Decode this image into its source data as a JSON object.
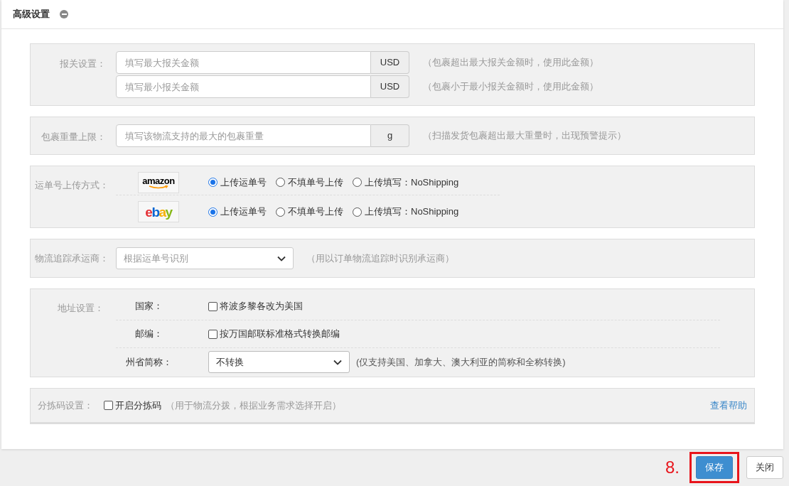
{
  "header": {
    "title": "高级设置"
  },
  "sections": [
    {
      "kind": "inputs",
      "label": "报关设置：",
      "rows": [
        {
          "placeholder": "填写最大报关金额",
          "addon": "USD",
          "hint": "（包裹超出最大报关金额时，使用此金额）"
        },
        {
          "placeholder": "填写最小报关金额",
          "addon": "USD",
          "hint": "（包裹小于最小报关金额时，使用此金额）"
        }
      ]
    },
    {
      "kind": "inputs",
      "label": "包裹重量上限：",
      "rows": [
        {
          "placeholder": "填写该物流支持的最大的包裹重量",
          "addon": "g",
          "hint": "（扫描发货包裹超出最大重量时，出现预警提示）"
        }
      ]
    },
    {
      "kind": "upload",
      "label": "运单号上传方式：",
      "platforms": [
        {
          "logo": "amazon",
          "options": [
            {
              "label": "上传运单号",
              "selected": true
            },
            {
              "label": "不填单号上传",
              "selected": false
            },
            {
              "label": "上传填写：NoShipping",
              "selected": false
            }
          ]
        },
        {
          "logo": "ebay",
          "options": [
            {
              "label": "上传运单号",
              "selected": true
            },
            {
              "label": "不填单号上传",
              "selected": false
            },
            {
              "label": "上传填写：NoShipping",
              "selected": false
            }
          ]
        }
      ]
    },
    {
      "kind": "carrier",
      "label": "物流追踪承运商：",
      "value": "根据运单号识别",
      "hint": "（用以订单物流追踪时识别承运商）"
    },
    {
      "kind": "address",
      "label": "地址设置：",
      "rows": [
        {
          "kind": "checkbox",
          "label": "国家：",
          "text": "将波多黎各改为美国",
          "checked": false
        },
        {
          "kind": "checkbox",
          "label": "邮编：",
          "text": "按万国邮联标准格式转换邮编",
          "checked": false
        },
        {
          "kind": "select",
          "label": "州省简称：",
          "value": "不转换",
          "hint": "(仅支持美国、加拿大、澳大利亚的简称和全称转换)"
        }
      ]
    },
    {
      "kind": "sorting",
      "label": "分拣码设置：",
      "checkbox": {
        "text": "开启分拣码",
        "checked": false
      },
      "hint": "（用于物流分拨，根据业务需求选择开启）",
      "link": "查看帮助"
    }
  ],
  "annotation": "8.",
  "buttons": [
    {
      "label": "保存",
      "kind": "primary",
      "highlighted": true
    },
    {
      "label": "关闭",
      "kind": "default",
      "highlighted": false
    }
  ]
}
